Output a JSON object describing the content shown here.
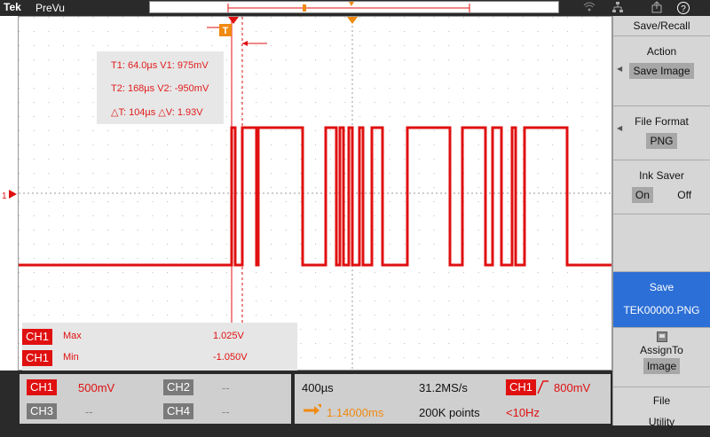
{
  "brand": "Tek",
  "mode": "PreVu",
  "colors": {
    "trace": "#e01010",
    "accent": "#f08a10",
    "selected": "#2c6fd6"
  },
  "toolbar_icons": [
    "wifi-icon",
    "network-icon",
    "export-icon",
    "help-icon"
  ],
  "help_label": "?",
  "cursor_readout": {
    "t1": "T1: 64.0µs  V1: 975mV",
    "t2": "T2: 168µs  V2: -950mV",
    "dt": "△T: 104µs  △V: 1.93V"
  },
  "trigger_marker": "T",
  "ch_marker": "1",
  "measurements": [
    {
      "ch": "CH1",
      "name": "Max",
      "value": "1.025V"
    },
    {
      "ch": "CH1",
      "name": "Min",
      "value": "-1.050V"
    }
  ],
  "channels": {
    "ch1": {
      "label": "CH1",
      "value": "500mV"
    },
    "ch2": {
      "label": "CH2",
      "value": "--"
    },
    "ch3": {
      "label": "CH3",
      "value": "--"
    },
    "ch4": {
      "label": "CH4",
      "value": "--"
    }
  },
  "timebase": {
    "scale": "400µs",
    "sample_rate": "31.2MS/s",
    "delay": "1.14000ms",
    "record": "200K points"
  },
  "trigger": {
    "source": "CH1",
    "level": "800mV",
    "freq": "<10Hz"
  },
  "side_panel": {
    "title": "Save/Recall",
    "action_label": "Action",
    "action_value": "Save Image",
    "format_label": "File Format",
    "format_value": "PNG",
    "ink_label": "Ink Saver",
    "ink_on": "On",
    "ink_off": "Off",
    "save_label": "Save",
    "save_file": "TEK00000.PNG",
    "assign_label": "AssignTo",
    "assign_value": "Image",
    "file_label": "File",
    "utility_label": "Utility"
  }
}
